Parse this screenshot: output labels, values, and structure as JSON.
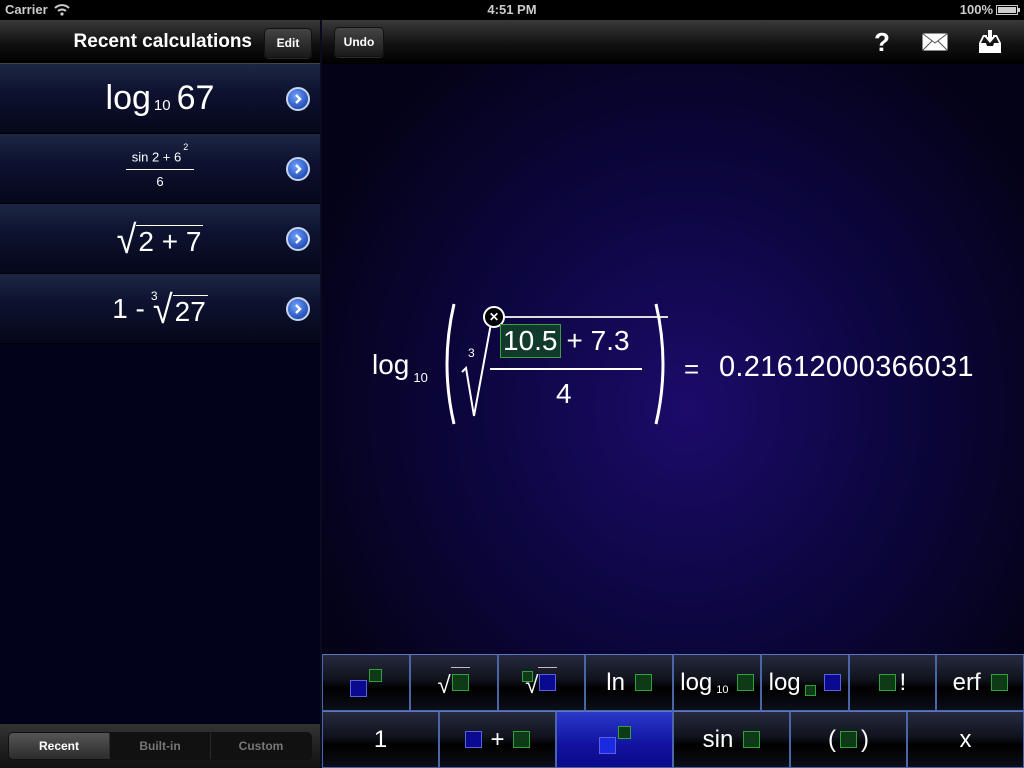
{
  "status_bar": {
    "carrier": "Carrier",
    "time": "4:51 PM",
    "battery": "100%",
    "battery_level": 1.0
  },
  "left_pane": {
    "title": "Recent calculations",
    "edit_label": "Edit",
    "recent": [
      {
        "type": "log",
        "func": "log",
        "base": "10",
        "arg": "67"
      },
      {
        "type": "fraction",
        "numerator": "sin 2 + 6",
        "exponent": "2",
        "denominator": "6"
      },
      {
        "type": "sqrt",
        "radicand": "2 + 7"
      },
      {
        "type": "root",
        "prefix": "1 -",
        "index": "3",
        "radicand": "27"
      }
    ],
    "segments": [
      {
        "label": "Recent",
        "active": true
      },
      {
        "label": "Built-in",
        "active": false
      },
      {
        "label": "Custom",
        "active": false
      }
    ]
  },
  "toolbar": {
    "undo_label": "Undo",
    "help_label": "?",
    "icons": [
      "help-icon",
      "mail-icon",
      "inbox-download-icon"
    ]
  },
  "formula": {
    "func": "log",
    "base": "10",
    "root_index": "3",
    "selected_term": "10.5",
    "rest_numerator": "+ 7.3",
    "denominator": "4",
    "equals": "=",
    "result": "0.21612000366031"
  },
  "keypad": {
    "row1": [
      {
        "id": "power",
        "label": ""
      },
      {
        "id": "sqrt",
        "label": ""
      },
      {
        "id": "nth-root",
        "label": ""
      },
      {
        "id": "ln",
        "label": "ln"
      },
      {
        "id": "log10",
        "label": "log",
        "sub": "10"
      },
      {
        "id": "log-base",
        "label": "log"
      },
      {
        "id": "factorial",
        "label": "!"
      },
      {
        "id": "erf",
        "label": "erf"
      }
    ],
    "row2": [
      {
        "id": "one",
        "label": "1"
      },
      {
        "id": "plus",
        "label": "+"
      },
      {
        "id": "power-active",
        "label": "",
        "active": true
      },
      {
        "id": "sin",
        "label": "sin"
      },
      {
        "id": "parens",
        "label_open": "(",
        "label_close": ")"
      },
      {
        "id": "x",
        "label": "x"
      }
    ]
  }
}
